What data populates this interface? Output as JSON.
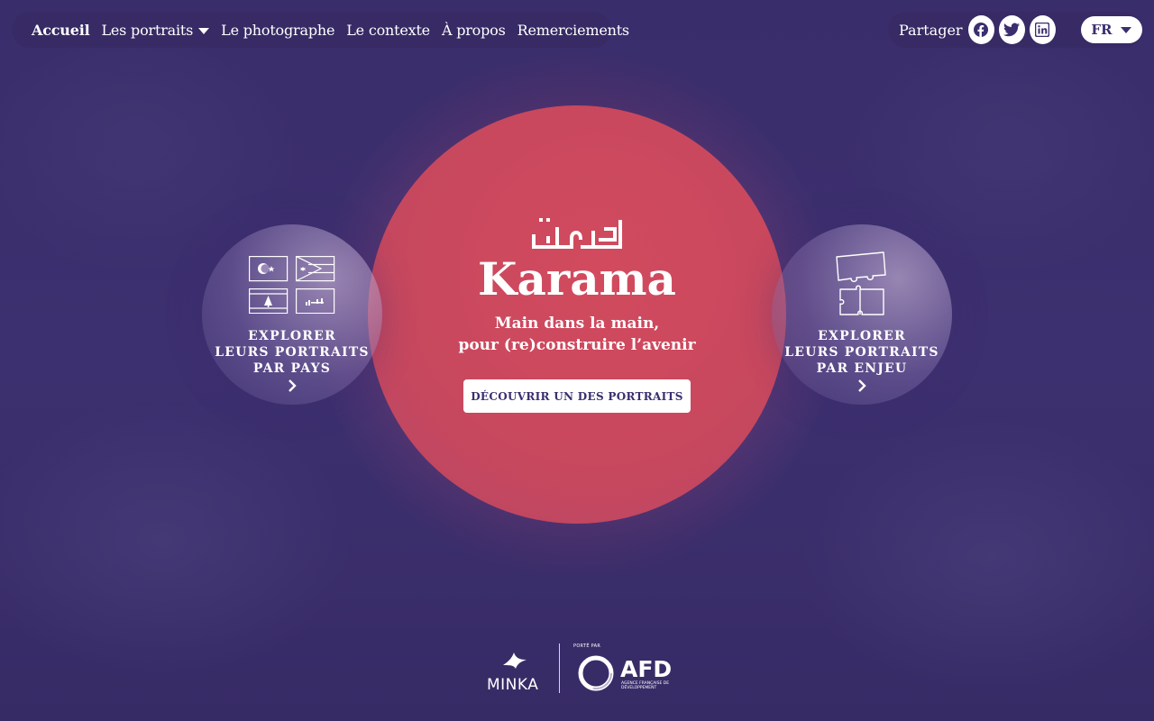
{
  "nav": {
    "items": [
      {
        "label": "Accueil",
        "active": true
      },
      {
        "label": "Les portraits",
        "dropdown": true
      },
      {
        "label": "Le photographe"
      },
      {
        "label": "Le contexte"
      },
      {
        "label": "À propos"
      },
      {
        "label": "Remerciements"
      }
    ]
  },
  "share": {
    "label": "Partager",
    "icons": [
      "facebook-icon",
      "twitter-icon",
      "linkedin-icon"
    ],
    "language": "FR"
  },
  "hero": {
    "arabic_title": "كرامة",
    "title": "Karama",
    "subtitle_line1": "Main dans la main,",
    "subtitle_line2": "pour (re)construire l’avenir",
    "cta": "DÉCOUVRIR UN DES PORTRAITS"
  },
  "explore_country": {
    "line1": "EXPLORER",
    "line2": "LEURS PORTRAITS",
    "line3": "PAR PAYS"
  },
  "explore_issue": {
    "line1": "EXPLORER",
    "line2": "LEURS PORTRAITS",
    "line3": "PAR ENJEU"
  },
  "footer": {
    "minka": "MINKA",
    "carried_by": "PORTÉ PAR",
    "afd": "AFD",
    "afd_sub": "AGENCE FRANÇAISE DE DÉVELOPPEMENT"
  },
  "colors": {
    "background": "#3b2e6e",
    "circle": "#c8485e",
    "white": "#ffffff"
  }
}
